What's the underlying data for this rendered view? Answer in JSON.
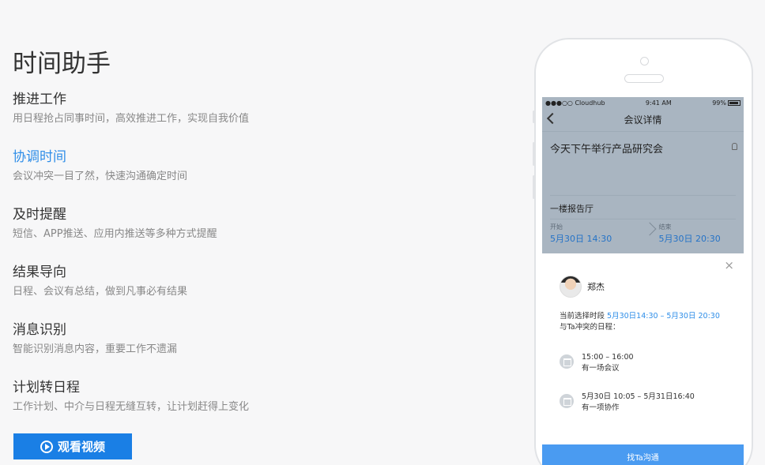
{
  "page": {
    "title": "时间助手"
  },
  "features": [
    {
      "title": "推进工作",
      "desc": "用日程抢占同事时间，高效推进工作，实现自我价值",
      "active": false
    },
    {
      "title": "协调时间",
      "desc": "会议冲突一目了然，快速沟通确定时间",
      "active": true
    },
    {
      "title": "及时提醒",
      "desc": "短信、APP推送、应用内推送等多种方式提醒",
      "active": false
    },
    {
      "title": "结果导向",
      "desc": "日程、会议有总结，做到凡事必有结果",
      "active": false
    },
    {
      "title": "消息识别",
      "desc": "智能识别消息内容，重要工作不遗漏",
      "active": false
    },
    {
      "title": "计划转日程",
      "desc": "工作计划、中介与日程无缝互转，让计划赶得上变化",
      "active": false
    }
  ],
  "video_button": {
    "label": "观看视频",
    "icon": "play-circle-icon"
  },
  "phone": {
    "status": {
      "carrier": "●●●○○ Cloudhub",
      "time": "9:41 AM",
      "battery": "99%"
    },
    "nav_title": "会议详情",
    "meeting_title": "今天下午举行产品研究会",
    "location": "一楼报告厅",
    "start": {
      "label": "开始",
      "value": "5月30日 14:30"
    },
    "end": {
      "label": "结束",
      "value": "5月30日 20:30"
    },
    "sheet": {
      "person_name": "郑杰",
      "range_prefix": "当前选择时段",
      "range_value": "5月30日14:30 – 5月30日 20:30",
      "range_suffix": "与Ta冲突的日程：",
      "conflicts": [
        {
          "time": "15:00 – 16:00",
          "desc": "有一场会议"
        },
        {
          "time": "5月30日 10:05 – 5月31日16:40",
          "desc": "有一项协作"
        }
      ],
      "close_symbol": "×",
      "contact_button": "找Ta沟通"
    }
  },
  "colors": {
    "accent": "#2f8ee8",
    "button": "#1a7fe5",
    "sheet_button": "#4a9bf1"
  }
}
